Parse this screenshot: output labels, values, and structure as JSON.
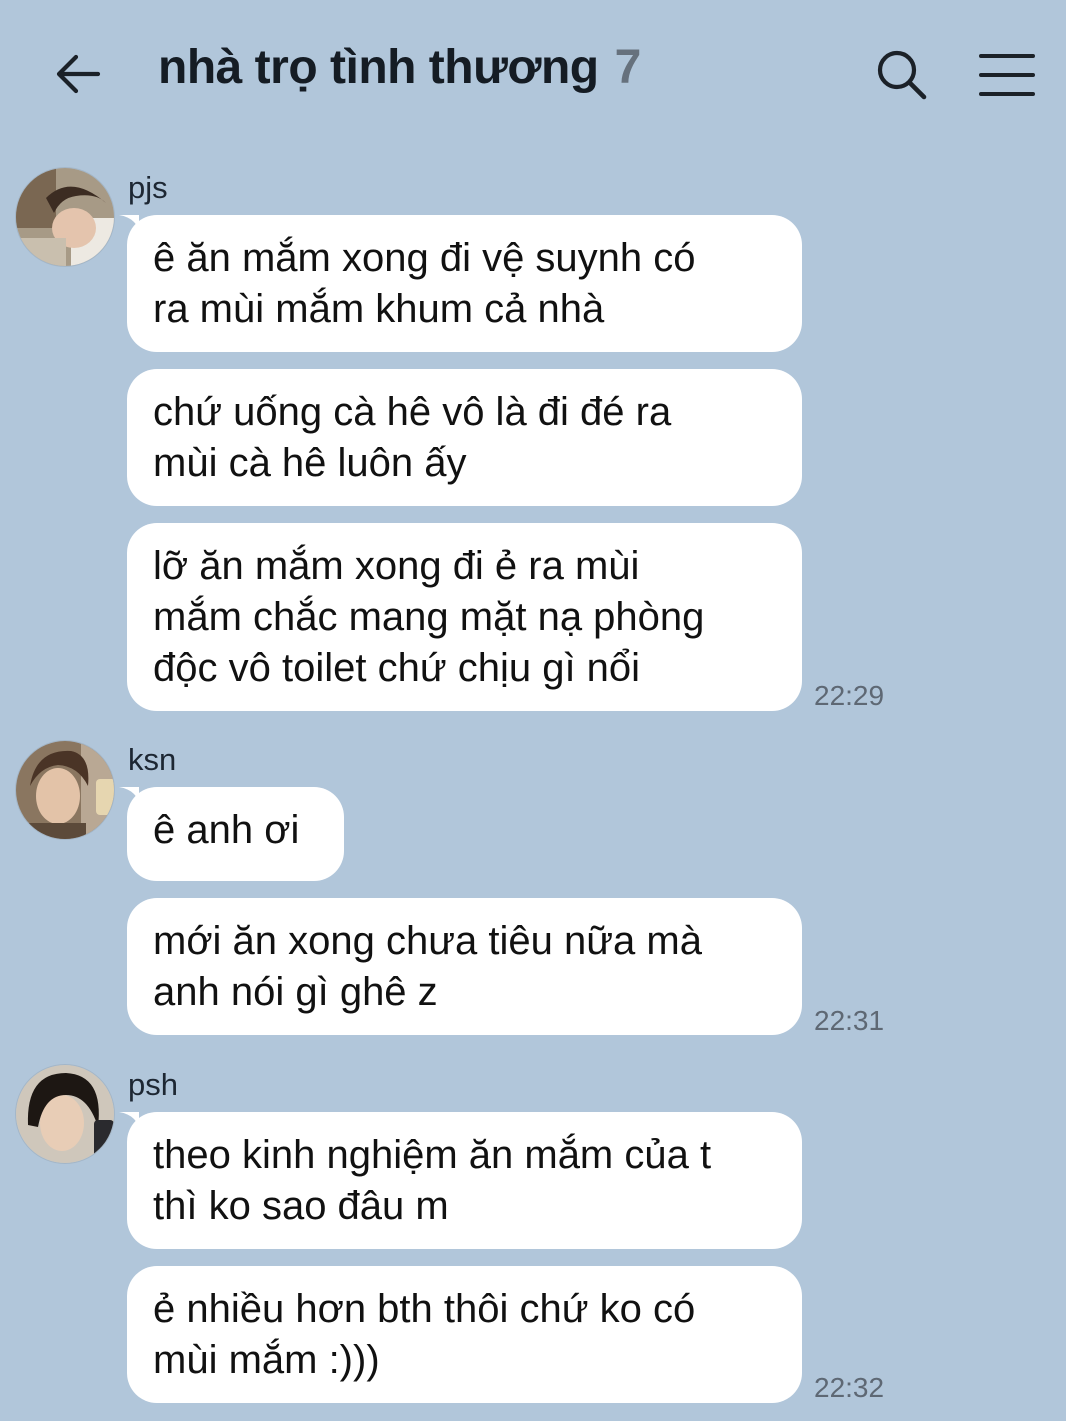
{
  "header": {
    "title": "nhà trọ tình thương",
    "member_count": "7",
    "back_icon": "arrow-left-icon",
    "search_icon": "search-icon",
    "menu_icon": "hamburger-menu-icon"
  },
  "groups": [
    {
      "sender": "pjs",
      "time": "22:29",
      "messages": [
        "ê ăn mắm xong đi vệ suynh có\nra mùi mắm khum cả nhà",
        "chứ uống cà hê vô là đi đé ra\nmùi cà hê luôn ấy",
        "lỡ ăn mắm xong đi ẻ ra mùi\nmắm chắc mang mặt nạ phòng\nđộc vô toilet chứ chịu gì nổi"
      ]
    },
    {
      "sender": "ksn",
      "time": "22:31",
      "messages": [
        "ê anh ơi",
        "mới ăn xong chưa tiêu nữa mà\nanh nói gì ghê z"
      ]
    },
    {
      "sender": "psh",
      "time": "22:32",
      "messages": [
        "theo kinh nghiệm ăn mắm của t\nthì ko sao đâu m",
        "ẻ nhiều hơn bth thôi chứ ko có\nmùi mắm :)))"
      ]
    }
  ],
  "colors": {
    "background": "#b1c6da",
    "bubble": "#ffffff",
    "title": "#151c24",
    "member_count": "#66717d",
    "timestamp": "#5e6874"
  }
}
